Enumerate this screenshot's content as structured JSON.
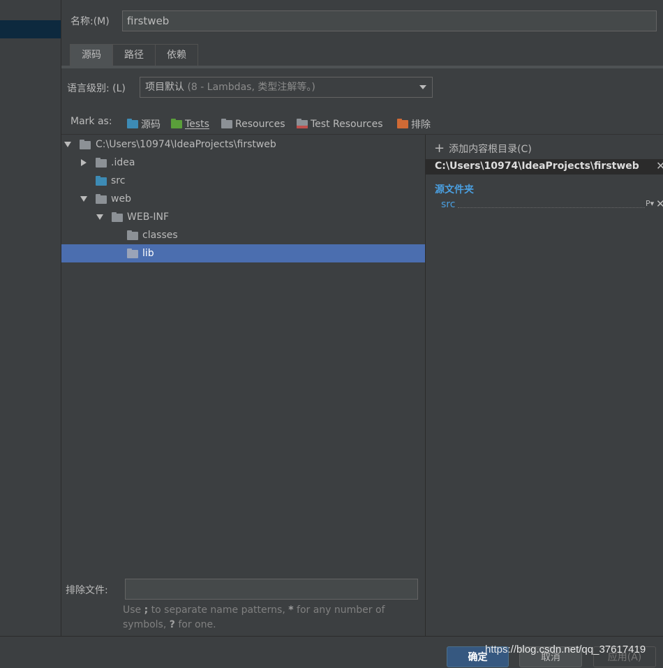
{
  "name_field": {
    "label": "名称:(M)",
    "value": "firstweb"
  },
  "tabs": [
    {
      "label": "源码",
      "active": true
    },
    {
      "label": "路径",
      "active": false
    },
    {
      "label": "依赖",
      "active": false
    }
  ],
  "language_level": {
    "label": "语言级别:  (L)",
    "selected_main": "项目默认",
    "selected_detail": "(8 - Lambdas, 类型注解等。)"
  },
  "mark_as": {
    "label": "Mark as:",
    "buttons": [
      {
        "label": "源码",
        "icon": "source-folder-icon",
        "color": "#3d8bb5"
      },
      {
        "label": "Tests",
        "icon": "test-folder-icon",
        "color": "#5a9e3a"
      },
      {
        "label": "Resources",
        "icon": "resources-folder-icon",
        "color": "#8c9196"
      },
      {
        "label": "Test Resources",
        "icon": "test-resources-folder-icon",
        "color": "#8c9196"
      },
      {
        "label": "排除",
        "icon": "excluded-folder-icon",
        "color": "#d06a35"
      }
    ]
  },
  "tree": {
    "rows": [
      {
        "label": "C:\\Users\\10974\\IdeaProjects\\firstweb",
        "expander": "expanded",
        "icon": "folder-icon",
        "selected": false
      },
      {
        "label": ".idea",
        "expander": "collapsed",
        "icon": "folder-icon",
        "selected": false
      },
      {
        "label": "src",
        "expander": "none",
        "icon": "source-folder-icon",
        "selected": false
      },
      {
        "label": "web",
        "expander": "expanded",
        "icon": "folder-icon",
        "selected": false
      },
      {
        "label": "WEB-INF",
        "expander": "expanded",
        "icon": "folder-icon",
        "selected": false
      },
      {
        "label": "classes",
        "expander": "none",
        "icon": "folder-icon",
        "selected": false
      },
      {
        "label": "lib",
        "expander": "none",
        "icon": "folder-icon",
        "selected": true
      }
    ]
  },
  "right_panel": {
    "add_root_label": "添加内容根目录(C)",
    "root_path": "C:\\Users\\10974\\IdeaProjects\\firstweb",
    "source_folders_title": "源文件夹",
    "source_folders": [
      {
        "label": "src",
        "prefix_icon": "P"
      }
    ]
  },
  "exclude": {
    "label": "排除文件:",
    "value": "",
    "hint_part1": "Use ",
    "hint_semicolon": ";",
    "hint_part2": " to separate name patterns, ",
    "hint_star": "*",
    "hint_part3": " for any number of symbols, ",
    "hint_q": "?",
    "hint_part4": " for one."
  },
  "buttons": {
    "ok": "确定",
    "cancel": "取消",
    "apply": "应用(A)"
  },
  "watermark": "https://blog.csdn.net/qq_37617419",
  "colors": {
    "background": "#3c3f41",
    "selection": "#4b6eaf",
    "link_blue": "#4a9fe0",
    "folder_gray": "#8c9196",
    "source_blue": "#3d8bb5"
  }
}
